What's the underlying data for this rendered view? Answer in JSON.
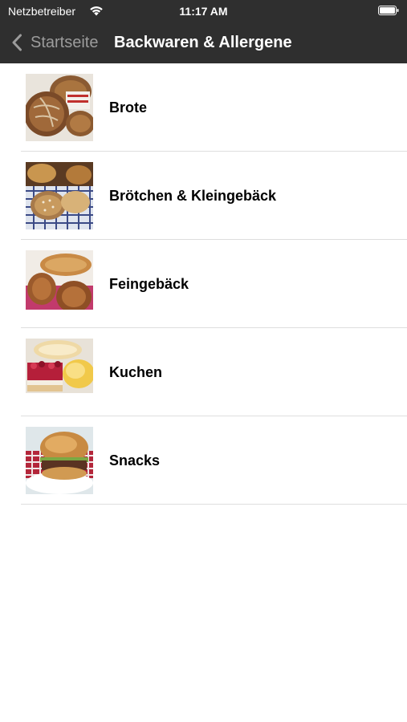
{
  "status_bar": {
    "carrier": "Netzbetreiber",
    "time": "11:17 AM",
    "wifi_icon": "wifi-icon",
    "battery_icon": "battery-icon"
  },
  "nav_bar": {
    "back_label": "Startseite",
    "back_icon": "chevron-left-icon",
    "title": "Backwaren & Allergene"
  },
  "categories": [
    {
      "label": "Brote",
      "image": "bread-loaves-image"
    },
    {
      "label": "Brötchen & Kleingebäck",
      "image": "rolls-image"
    },
    {
      "label": "Feingebäck",
      "image": "pastries-image"
    },
    {
      "label": "Kuchen",
      "image": "cakes-image"
    },
    {
      "label": "Snacks",
      "image": "burger-snack-image"
    }
  ],
  "colors": {
    "nav_background": "#2f2f2f",
    "separator": "#dedede"
  }
}
